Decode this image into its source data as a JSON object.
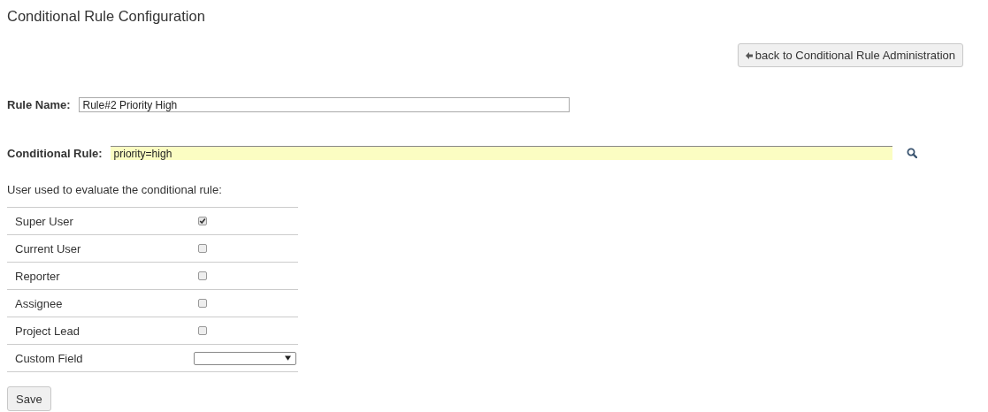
{
  "title": "Conditional Rule Configuration",
  "back_button": {
    "label": "back to Conditional Rule Administration"
  },
  "rule_name": {
    "label": "Rule Name:",
    "value": "Rule#2 Priority High"
  },
  "conditional_rule": {
    "label": "Conditional Rule:",
    "value": "priority=high"
  },
  "users_heading": "User used to evaluate the conditional rule:",
  "user_options": [
    {
      "label": "Super User",
      "kind": "checkbox",
      "checked": true
    },
    {
      "label": "Current User",
      "kind": "checkbox",
      "checked": false
    },
    {
      "label": "Reporter",
      "kind": "checkbox",
      "checked": false
    },
    {
      "label": "Assignee",
      "kind": "checkbox",
      "checked": false
    },
    {
      "label": "Project Lead",
      "kind": "checkbox",
      "checked": false
    },
    {
      "label": "Custom Field",
      "kind": "select"
    }
  ],
  "save_button": {
    "label": "Save"
  }
}
